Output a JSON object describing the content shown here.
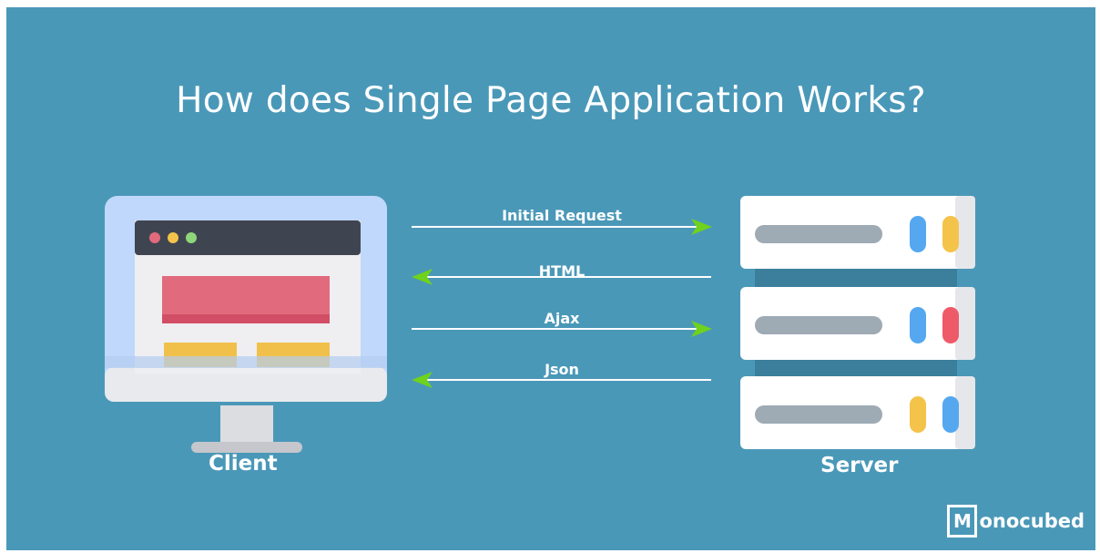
{
  "title": "How does Single Page Application Works?",
  "client_label": "Client",
  "server_label": "Server",
  "arrows": [
    {
      "label": "Initial Request",
      "direction": "to-server"
    },
    {
      "label": "HTML",
      "direction": "to-client"
    },
    {
      "label": "Ajax",
      "direction": "to-server"
    },
    {
      "label": "Json",
      "direction": "to-client"
    }
  ],
  "logo": {
    "letter": "M",
    "text": "onocubed"
  },
  "colors": {
    "background": "#4a98b8",
    "arrow_line": "#ffffff",
    "arrow_head": "#6fd21c",
    "monitor_frame": "#bfd8fb",
    "screen_bar": "#3f4550",
    "hero_block": "#e26a7d",
    "yellow_block": "#f4c34a",
    "server_panel": "#ffffff",
    "server_slot": "#9eaab4"
  },
  "icons": [
    "monitor-icon",
    "server-rack-icon"
  ]
}
